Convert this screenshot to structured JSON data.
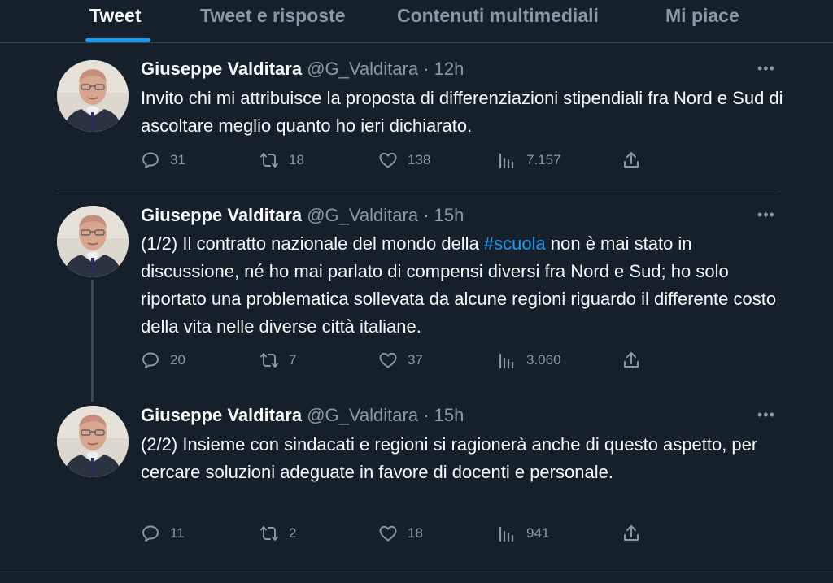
{
  "tabs": [
    {
      "label": "Tweet",
      "active": true
    },
    {
      "label": "Tweet e risposte",
      "active": false
    },
    {
      "label": "Contenuti multimediali",
      "active": false
    },
    {
      "label": "Mi piace",
      "active": false
    }
  ],
  "tweets": [
    {
      "name": "Giuseppe Valditara",
      "handle": "@G_Valditara",
      "separator": "·",
      "time": "12h",
      "text": "Invito chi mi attribuisce la proposta di differenziazioni stipendiali fra Nord e Sud di ascoltare meglio quanto ho ieri dichiarato.",
      "replies": "31",
      "retweets": "18",
      "likes": "138",
      "views": "7.157"
    },
    {
      "name": "Giuseppe Valditara",
      "handle": "@G_Valditara",
      "separator": "·",
      "time": "15h",
      "text_before": "(1/2) Il contratto nazionale del mondo della ",
      "hashtag": "#scuola",
      "text_after": " non è mai stato in discussione, né ho mai parlato di compensi diversi fra Nord e Sud; ho solo riportato una problematica sollevata da alcune regioni riguardo il differente costo della vita nelle diverse città italiane.",
      "replies": "20",
      "retweets": "7",
      "likes": "37",
      "views": "3.060"
    },
    {
      "name": "Giuseppe Valditara",
      "handle": "@G_Valditara",
      "separator": "·",
      "time": "15h",
      "text": "(2/2) Insieme con sindacati e regioni si ragionerà anche di questo aspetto, per cercare soluzioni adeguate in favore di docenti e personale.",
      "replies": "11",
      "retweets": "2",
      "likes": "18",
      "views": "941"
    }
  ],
  "colors": {
    "background": "#15202b",
    "accent": "#1d9bf0",
    "secondary_text": "#8b98a5"
  }
}
